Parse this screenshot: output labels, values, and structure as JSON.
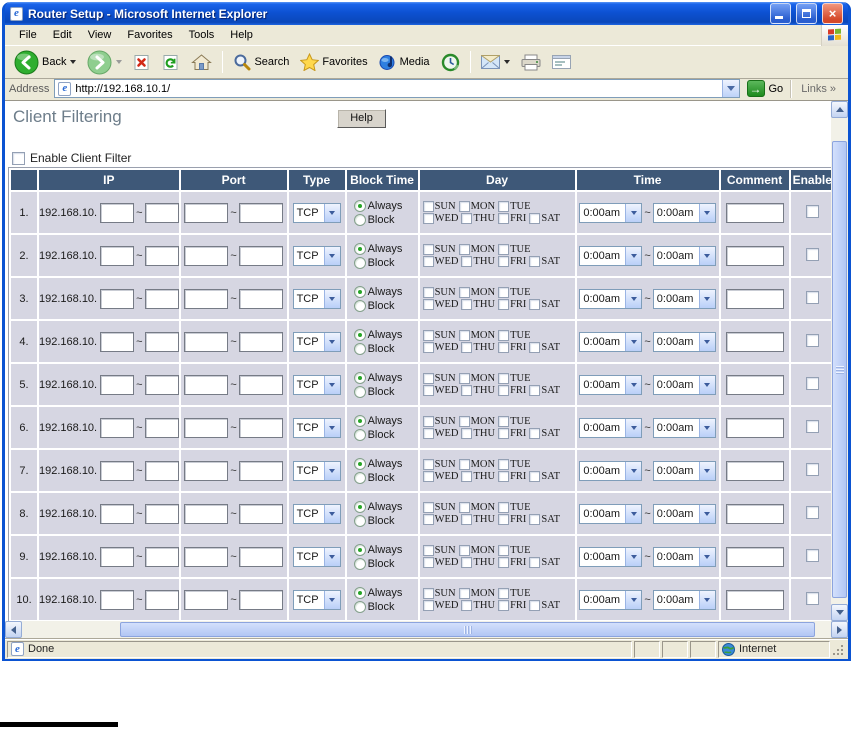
{
  "window": {
    "title": "Router Setup - Microsoft Internet Explorer"
  },
  "menu": {
    "items": [
      "File",
      "Edit",
      "View",
      "Favorites",
      "Tools",
      "Help"
    ]
  },
  "toolbar": {
    "back": "Back",
    "search": "Search",
    "favorites": "Favorites",
    "media": "Media"
  },
  "address": {
    "label": "Address",
    "url": "http://192.168.10.1/",
    "go": "Go",
    "links": "Links",
    "links_chevron": "»"
  },
  "page": {
    "title": "Client Filtering",
    "help": "Help",
    "enable_filter": "Enable Client Filter",
    "enable_filter_checked": false
  },
  "table": {
    "headers": [
      "",
      "IP",
      "Port",
      "Type",
      "Block Time",
      "Day",
      "Time",
      "Comment",
      "Enable"
    ],
    "tilde": "~",
    "day_labels": [
      "SUN",
      "MON",
      "TUE",
      "WED",
      "THU",
      "FRI",
      "SAT"
    ],
    "block_time_options": [
      "Always",
      "Block"
    ],
    "colors": {
      "header_bg": "#3E5878",
      "row_bg": "#D6D6E2",
      "titlebar_blue": "#0d51d2",
      "chrome_tan": "#ECE9D8"
    },
    "rows": [
      {
        "num": "1.",
        "ip_prefix": "192.168.10.",
        "ip_from": "",
        "ip_to": "",
        "port_from": "",
        "port_to": "",
        "type": "TCP",
        "block_time": "Always",
        "time_from": "0:00am",
        "time_to": "0:00am",
        "comment": "",
        "enabled": false
      },
      {
        "num": "2.",
        "ip_prefix": "192.168.10.",
        "ip_from": "",
        "ip_to": "",
        "port_from": "",
        "port_to": "",
        "type": "TCP",
        "block_time": "Always",
        "time_from": "0:00am",
        "time_to": "0:00am",
        "comment": "",
        "enabled": false
      },
      {
        "num": "3.",
        "ip_prefix": "192.168.10.",
        "ip_from": "",
        "ip_to": "",
        "port_from": "",
        "port_to": "",
        "type": "TCP",
        "block_time": "Always",
        "time_from": "0:00am",
        "time_to": "0:00am",
        "comment": "",
        "enabled": false
      },
      {
        "num": "4.",
        "ip_prefix": "192.168.10.",
        "ip_from": "",
        "ip_to": "",
        "port_from": "",
        "port_to": "",
        "type": "TCP",
        "block_time": "Always",
        "time_from": "0:00am",
        "time_to": "0:00am",
        "comment": "",
        "enabled": false
      },
      {
        "num": "5.",
        "ip_prefix": "192.168.10.",
        "ip_from": "",
        "ip_to": "",
        "port_from": "",
        "port_to": "",
        "type": "TCP",
        "block_time": "Always",
        "time_from": "0:00am",
        "time_to": "0:00am",
        "comment": "",
        "enabled": false
      },
      {
        "num": "6.",
        "ip_prefix": "192.168.10.",
        "ip_from": "",
        "ip_to": "",
        "port_from": "",
        "port_to": "",
        "type": "TCP",
        "block_time": "Always",
        "time_from": "0:00am",
        "time_to": "0:00am",
        "comment": "",
        "enabled": false
      },
      {
        "num": "7.",
        "ip_prefix": "192.168.10.",
        "ip_from": "",
        "ip_to": "",
        "port_from": "",
        "port_to": "",
        "type": "TCP",
        "block_time": "Always",
        "time_from": "0:00am",
        "time_to": "0:00am",
        "comment": "",
        "enabled": false
      },
      {
        "num": "8.",
        "ip_prefix": "192.168.10.",
        "ip_from": "",
        "ip_to": "",
        "port_from": "",
        "port_to": "",
        "type": "TCP",
        "block_time": "Always",
        "time_from": "0:00am",
        "time_to": "0:00am",
        "comment": "",
        "enabled": false
      },
      {
        "num": "9.",
        "ip_prefix": "192.168.10.",
        "ip_from": "",
        "ip_to": "",
        "port_from": "",
        "port_to": "",
        "type": "TCP",
        "block_time": "Always",
        "time_from": "0:00am",
        "time_to": "0:00am",
        "comment": "",
        "enabled": false
      },
      {
        "num": "10.",
        "ip_prefix": "192.168.10.",
        "ip_from": "",
        "ip_to": "",
        "port_from": "",
        "port_to": "",
        "type": "TCP",
        "block_time": "Always",
        "time_from": "0:00am",
        "time_to": "0:00am",
        "comment": "",
        "enabled": false
      }
    ]
  },
  "status": {
    "done": "Done",
    "zone": "Internet"
  }
}
